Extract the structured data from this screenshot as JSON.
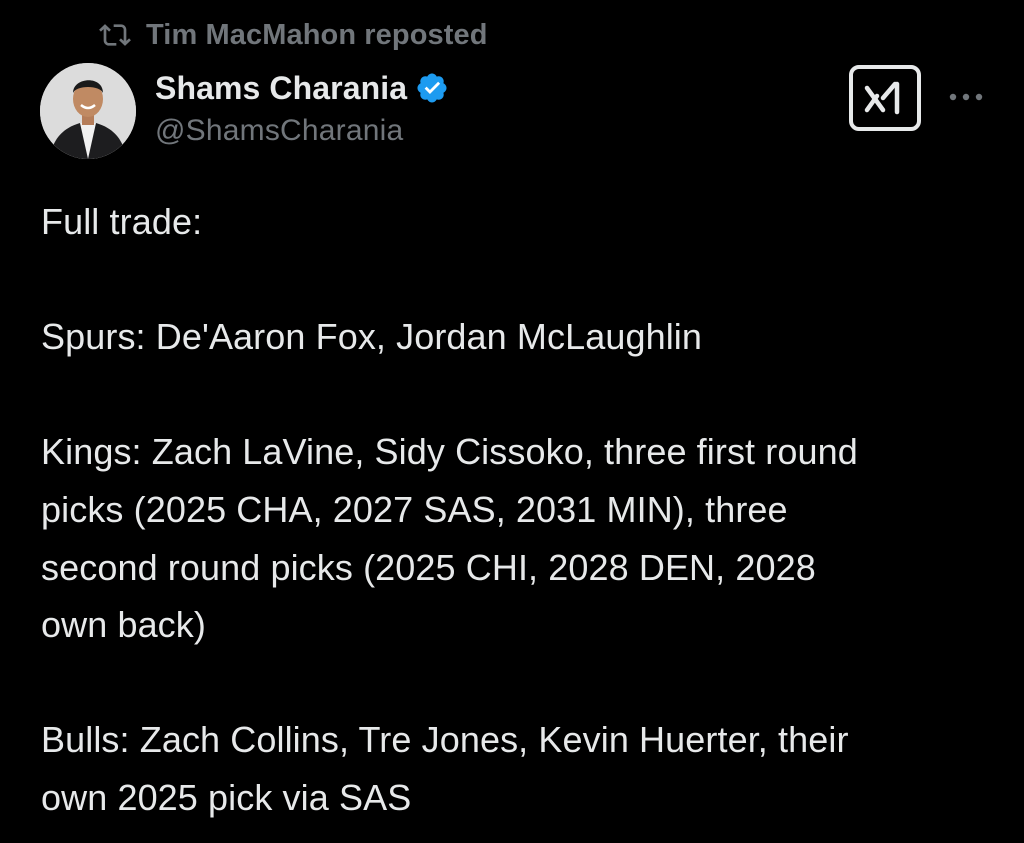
{
  "repost": {
    "icon": "repost-icon",
    "text": "Tim MacMahon reposted"
  },
  "author": {
    "avatar_icon": "avatar",
    "name": "Shams Charania",
    "verified_icon": "verified-badge-icon",
    "verified_color": "#1d9bf0",
    "handle": "@ShamsCharania"
  },
  "actions": {
    "grok_icon": "x-ai-grok-icon",
    "more_icon": "more-options-icon"
  },
  "tweet": {
    "line1": "Full trade:",
    "spurs": "Spurs: De'Aaron Fox, Jordan McLaughlin",
    "kings_l1": "Kings: Zach LaVine, Sidy Cissoko, three first round",
    "kings_l2": "picks (2025 CHA, 2027 SAS, 2031 MIN), three",
    "kings_l3": "second round picks (2025 CHI, 2028 DEN, 2028",
    "kings_l4": "own back)",
    "bulls_l1": "Bulls: Zach Collins, Tre Jones, Kevin Huerter, their",
    "bulls_l2": "own 2025 pick via SAS"
  },
  "colors": {
    "background": "#000000",
    "text_primary": "#e7e9ea",
    "text_secondary": "#71767b"
  }
}
